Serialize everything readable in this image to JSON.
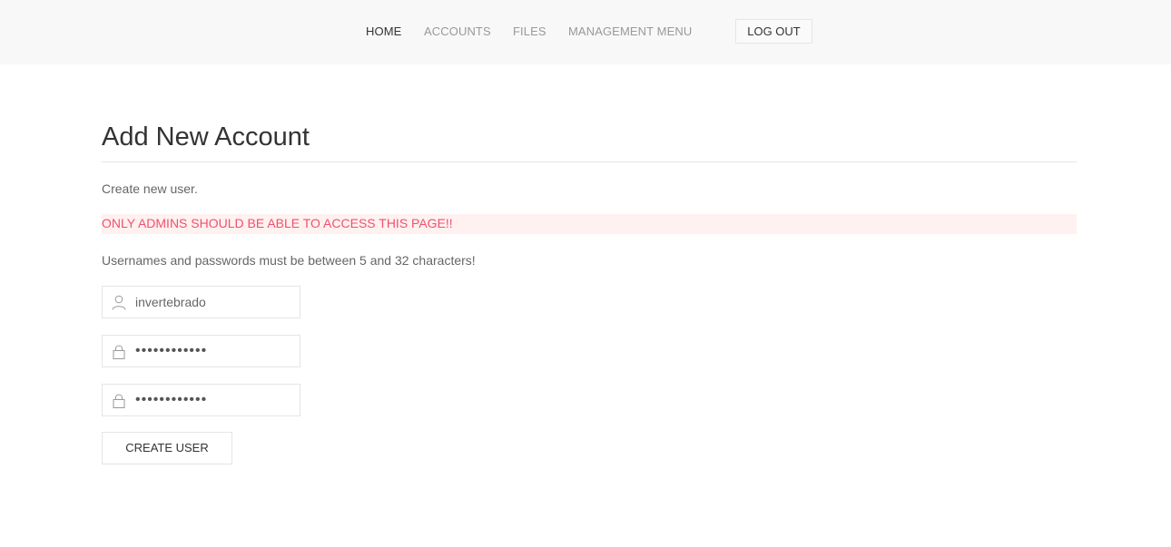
{
  "nav": {
    "items": [
      {
        "label": "HOME",
        "active": true
      },
      {
        "label": "ACCOUNTS",
        "active": false
      },
      {
        "label": "FILES",
        "active": false
      },
      {
        "label": "MANAGEMENT MENU",
        "active": false
      }
    ],
    "logout_label": "LOG OUT"
  },
  "page": {
    "title": "Add New Account",
    "intro": "Create new user.",
    "alert": "ONLY ADMINS SHOULD BE ABLE TO ACCESS THIS PAGE!!",
    "rules": "Usernames and passwords must be between 5 and 32 characters!"
  },
  "form": {
    "username": {
      "value": "invertebrado",
      "icon": "user-icon"
    },
    "password": {
      "value": "••••••••••••",
      "icon": "lock-icon"
    },
    "confirm_password": {
      "value": "••••••••••••",
      "icon": "lock-icon"
    },
    "submit_label": "CREATE USER"
  },
  "colors": {
    "alert_text": "#f0506e",
    "alert_background": "#fff1f0",
    "navbar_background": "#f8f8f8"
  }
}
